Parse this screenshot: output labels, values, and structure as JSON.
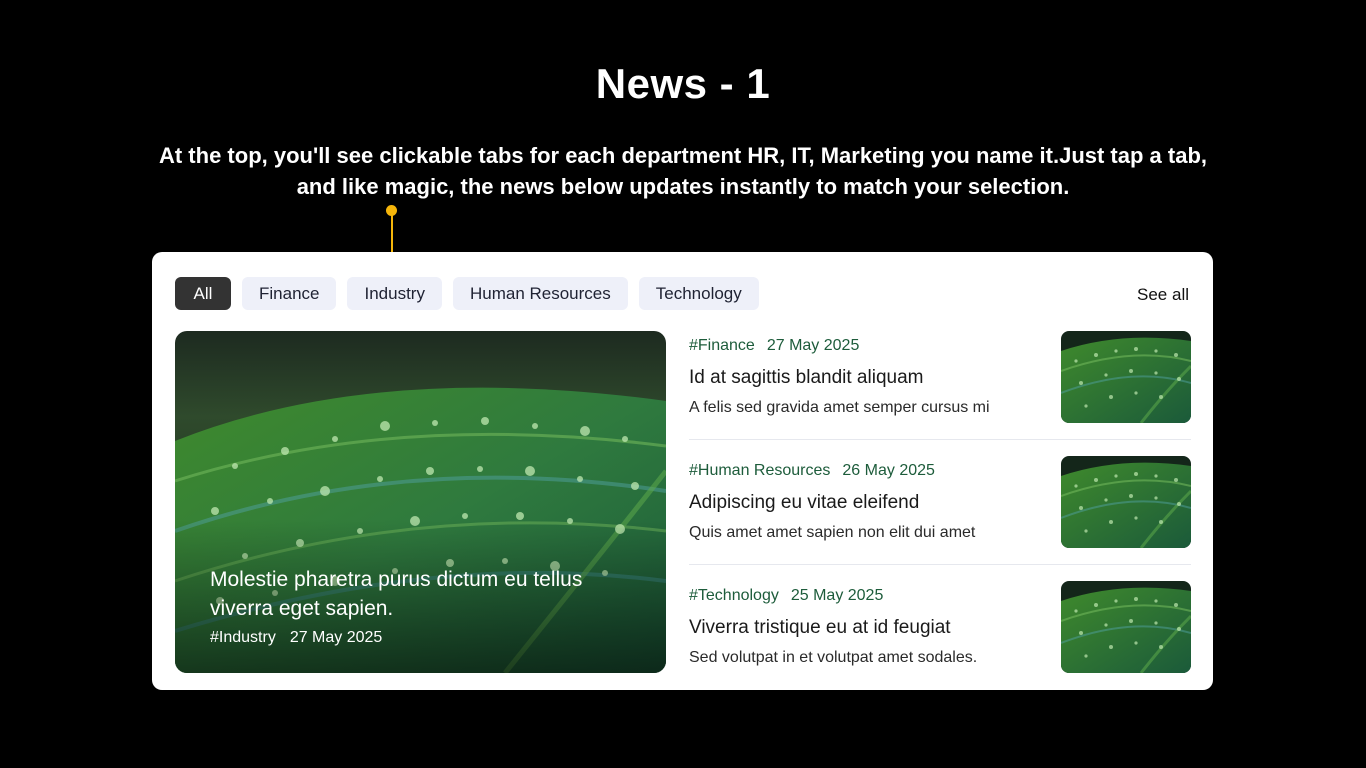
{
  "header": {
    "title": "News - 1",
    "description": "At the top, you'll see clickable tabs for each department HR, IT, Marketing you name it.Just tap a tab, and like magic, the news below updates instantly to match your selection."
  },
  "colors": {
    "accent_callout": "#f5b50a",
    "tag_green": "#1d5c3b",
    "active_tab": "#333333",
    "inactive_tab": "#eef0f9"
  },
  "tabs": [
    {
      "label": "All",
      "active": true
    },
    {
      "label": "Finance",
      "active": false
    },
    {
      "label": "Industry",
      "active": false
    },
    {
      "label": "Human Resources",
      "active": false
    },
    {
      "label": "Technology",
      "active": false
    }
  ],
  "see_all_label": "See all",
  "featured": {
    "title": "Molestie pharetra purus dictum eu tellus viverra eget sapien.",
    "tag": "#Industry",
    "date": "27 May 2025"
  },
  "news": [
    {
      "tag": "#Finance",
      "date": "27 May 2025",
      "title": "Id at sagittis blandit aliquam",
      "summary": "A felis sed gravida amet semper cursus mi"
    },
    {
      "tag": "#Human Resources",
      "date": "26 May 2025",
      "title": "Adipiscing eu vitae eleifend",
      "summary": "Quis amet amet sapien non elit dui amet"
    },
    {
      "tag": "#Technology",
      "date": "25 May 2025",
      "title": "Viverra tristique eu at id feugiat",
      "summary": "Sed volutpat in et volutpat amet sodales."
    }
  ]
}
